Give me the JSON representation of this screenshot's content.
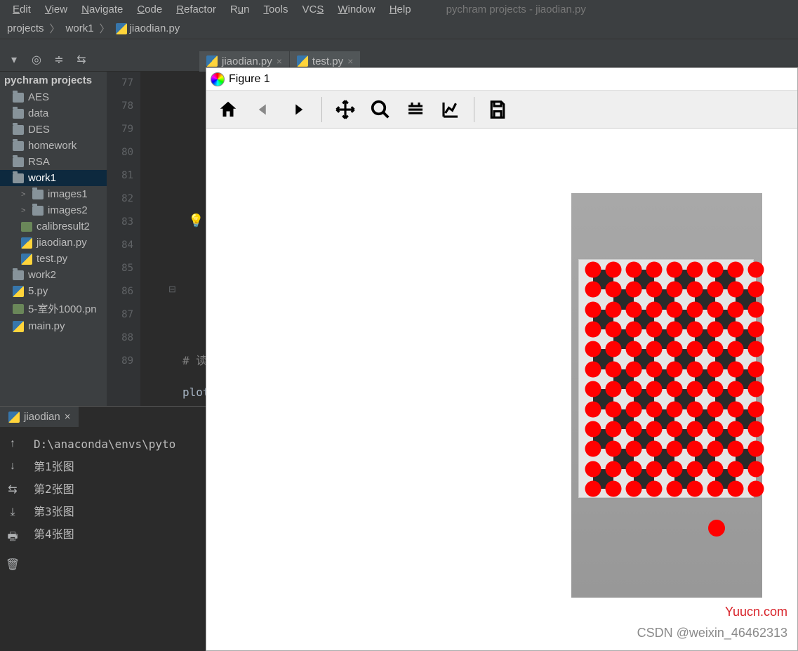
{
  "menu": [
    "Edit",
    "View",
    "Navigate",
    "Code",
    "Refactor",
    "Run",
    "Tools",
    "VCS",
    "Window",
    "Help"
  ],
  "menu_underline": [
    0,
    0,
    0,
    0,
    0,
    0,
    0,
    2,
    0,
    0
  ],
  "window_title": "pychram projects - jiaodian.py",
  "breadcrumbs": [
    "projects",
    "work1",
    "jiaodian.py"
  ],
  "tabs": [
    {
      "label": "jiaodian.py",
      "active": true
    },
    {
      "label": "test.py",
      "active": false
    }
  ],
  "project_title": "pychram projects",
  "tree": [
    {
      "label": "AES",
      "icon": "folder",
      "indent": 1
    },
    {
      "label": "data",
      "icon": "folder",
      "indent": 1
    },
    {
      "label": "DES",
      "icon": "folder",
      "indent": 1
    },
    {
      "label": "homework",
      "icon": "folder",
      "indent": 1
    },
    {
      "label": "RSA",
      "icon": "folder",
      "indent": 1
    },
    {
      "label": "work1",
      "icon": "folder",
      "indent": 1,
      "selected": true
    },
    {
      "label": "images1",
      "icon": "folder",
      "indent": 2,
      "chev": ">"
    },
    {
      "label": "images2",
      "icon": "folder",
      "indent": 2,
      "chev": ">"
    },
    {
      "label": "calibresult2",
      "icon": "img",
      "indent": 2
    },
    {
      "label": "jiaodian.py",
      "icon": "py",
      "indent": 2
    },
    {
      "label": "test.py",
      "icon": "py",
      "indent": 2
    },
    {
      "label": "work2",
      "icon": "folder",
      "indent": 1
    },
    {
      "label": "5.py",
      "icon": "py",
      "indent": 1
    },
    {
      "label": "5-室外1000.pn",
      "icon": "img",
      "indent": 1
    },
    {
      "label": "main.py",
      "icon": "py",
      "indent": 1
    }
  ],
  "gutter_lines": [
    "77",
    "78",
    "79",
    "80",
    "81",
    "82",
    "83",
    "84",
    "85",
    "86",
    "87",
    "88",
    "89"
  ],
  "code_comment": "#  读",
  "code_plot": "plot",
  "run_tab": "jiaodian",
  "console": {
    "path": "D:\\anaconda\\envs\\pyto",
    "lines": [
      "第1张图",
      "第2张图",
      "第3张图",
      "第4张图"
    ]
  },
  "figure": {
    "title": "Figure 1",
    "toolbar": [
      "home",
      "back",
      "forward",
      "|",
      "pan",
      "zoom",
      "subplots",
      "axes",
      "|",
      "save"
    ]
  },
  "watermark1": "Yuucn.com",
  "watermark2": "CSDN @weixin_46462313"
}
